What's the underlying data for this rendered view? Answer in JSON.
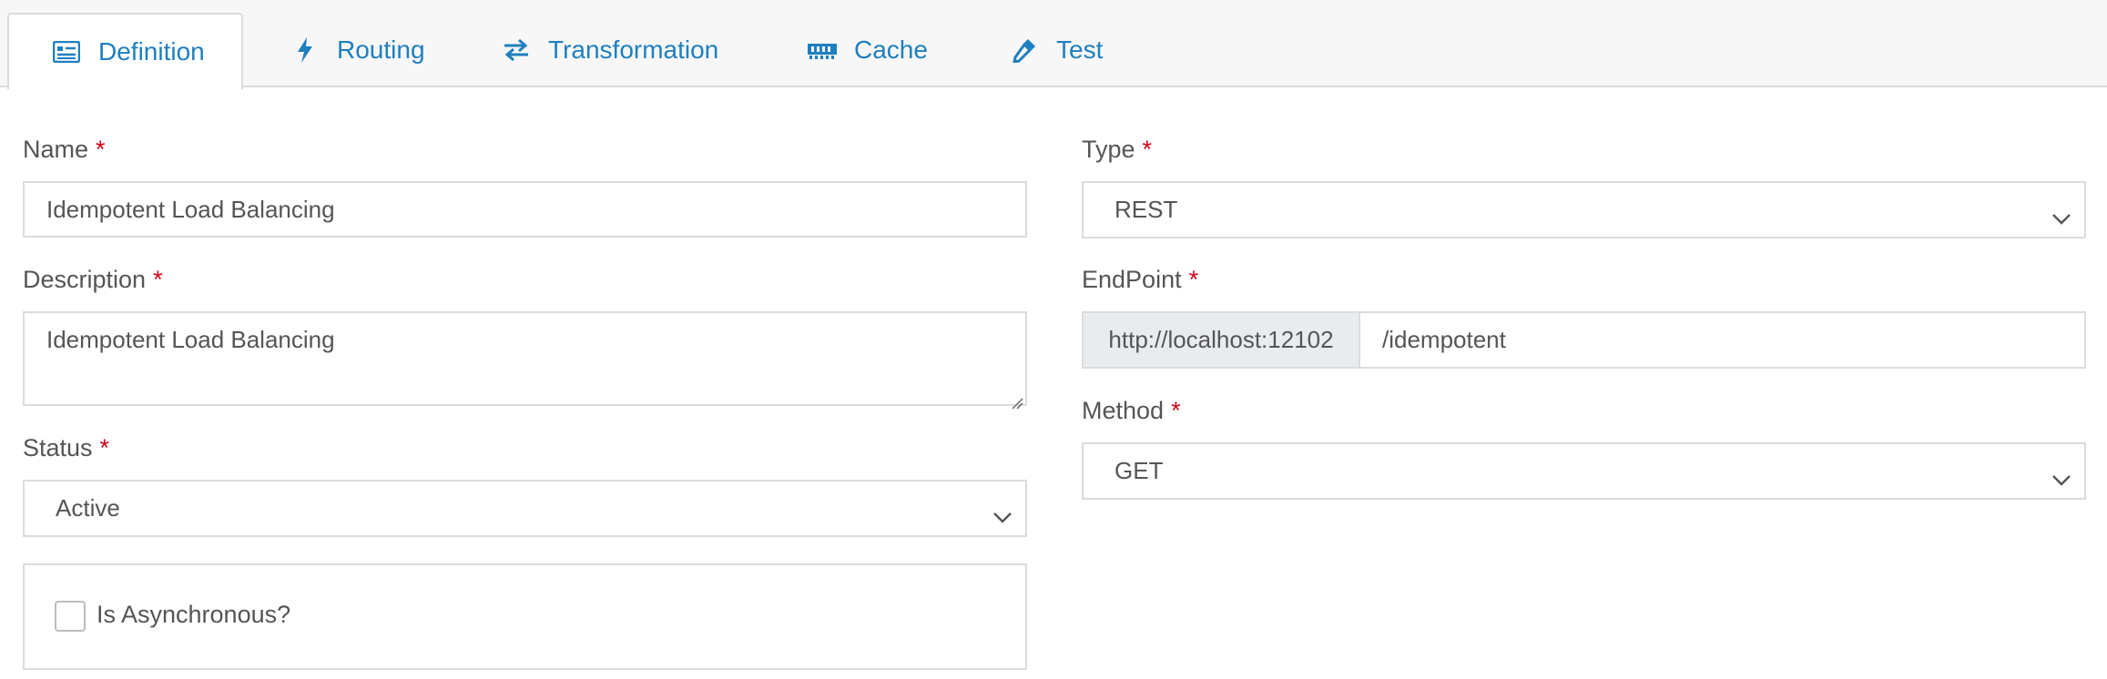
{
  "tabs": [
    {
      "label": "Definition",
      "icon": "list-icon"
    },
    {
      "label": "Routing",
      "icon": "bolt-icon"
    },
    {
      "label": "Transformation",
      "icon": "swap-arrows-icon"
    },
    {
      "label": "Cache",
      "icon": "memory-icon"
    },
    {
      "label": "Test",
      "icon": "dropper-icon"
    }
  ],
  "required_mark": "*",
  "form": {
    "name": {
      "label": "Name",
      "value": "Idempotent Load Balancing"
    },
    "description": {
      "label": "Description",
      "value": "Idempotent Load Balancing"
    },
    "status": {
      "label": "Status",
      "value": "Active"
    },
    "async": {
      "label": "Is Asynchronous?",
      "checked": false
    },
    "type": {
      "label": "Type",
      "value": "REST"
    },
    "endpoint": {
      "label": "EndPoint",
      "prefix": "http://localhost:12102",
      "value": "/idempotent"
    },
    "method": {
      "label": "Method",
      "value": "GET"
    }
  },
  "colors": {
    "accent": "#1f7fbf",
    "required": "#d0021b",
    "border": "#dcdcdc",
    "addon_bg": "#e9ecef"
  }
}
